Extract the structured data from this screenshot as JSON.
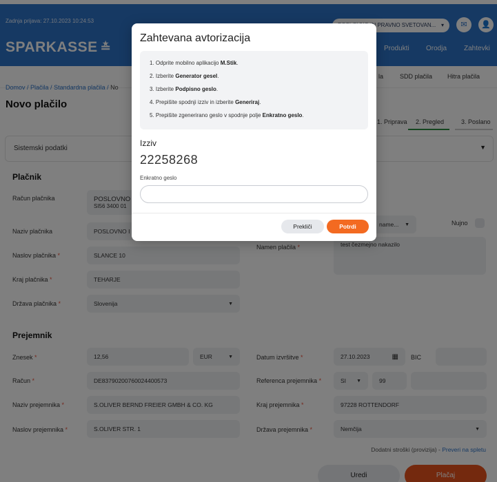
{
  "header": {
    "last_login": "Zadnja prijava: 27.10.2023 10:24:53",
    "account_selector": "POSLOVNO IN PRAVNO SVETOVAN...",
    "logo_text": "SPARKASSE",
    "nav": [
      "Produkti",
      "Orodja",
      "Zahtevki"
    ]
  },
  "subnav": [
    "la",
    "SDD plačila",
    "Hitra plačila"
  ],
  "breadcrumb": {
    "items": [
      "Domov",
      "Plačila",
      "Standardna plačila"
    ],
    "current": "No"
  },
  "page_title": "Novo plačilo",
  "steps": [
    "1. Priprava",
    "2. Pregled",
    "3. Poslano"
  ],
  "sistemski": {
    "label": "Sistemski podatki"
  },
  "placnik": {
    "title": "Plačnik",
    "racun_label": "Račun plačnika",
    "racun_line1": "POSLOVNO",
    "racun_line2": "SI56 3400 01",
    "naziv_label": "Naziv plačnika",
    "naziv_value": "POSLOVNO I",
    "naslov_label": "Naslov plačnika",
    "naslov_value": "SLANCE 10",
    "kraj_label": "Kraj plačnika",
    "kraj_value": "TEHARJE",
    "drzava_label": "Država plačnika",
    "drzava_value": "Slovenija",
    "namen_select": "name...",
    "nujno_label": "Nujno",
    "namen_label": "Namen plačila",
    "namen_value": "test čezmejno nakazilo"
  },
  "prejemnik": {
    "title": "Prejemnik",
    "znesek_label": "Znesek",
    "znesek_value": "12,56",
    "currency": "EUR",
    "datum_label": "Datum izvršitve",
    "datum_value": "27.10.2023",
    "bic_label": "BIC",
    "racun_label": "Račun",
    "racun_value": "DE83790200760024400573",
    "referenca_label": "Referenca prejemnika",
    "ref_model": "SI",
    "ref_num": "99",
    "naziv_label": "Naziv prejemnika",
    "naziv_value": "S.OLIVER BERND FREIER GMBH & CO. KG",
    "kraj_label": "Kraj prejemnika",
    "kraj_value": "97228 ROTTENDORF",
    "naslov_label": "Naslov prejemnika",
    "naslov_value": "S.OLIVER STR. 1",
    "drzava_label": "Država prejemnika",
    "drzava_value": "Nemčija"
  },
  "footer": {
    "stroski": "Dodatni stroški (provizija) - ",
    "preveri": "Preveri na spletu",
    "uredi": "Uredi",
    "placaj": "Plačaj"
  },
  "modal": {
    "title": "Zahtevana avtorizacija",
    "steps": [
      {
        "pre": "1. Odprite mobilno aplikacijo ",
        "bold": "M.Stik",
        "post": "."
      },
      {
        "pre": "2. Izberite ",
        "bold": "Generator gesel",
        "post": "."
      },
      {
        "pre": "3. Izberite ",
        "bold": "Podpisno geslo",
        "post": "."
      },
      {
        "pre": "4. Prepišite spodnji izziv in izberite ",
        "bold": "Generiraj",
        "post": "."
      },
      {
        "pre": "5. Prepišite zgenerirano geslo v spodnje polje ",
        "bold": "Enkratno geslo",
        "post": "."
      }
    ],
    "izziv_label": "Izziv",
    "izziv_code": "22258268",
    "otp_label": "Enkratno geslo",
    "otp_value": "",
    "cancel": "Prekliči",
    "confirm": "Potrdi"
  },
  "colors": {
    "brand_blue": "#2c72c7",
    "accent_orange": "#f36a21",
    "step_active": "#2b8a3e"
  }
}
